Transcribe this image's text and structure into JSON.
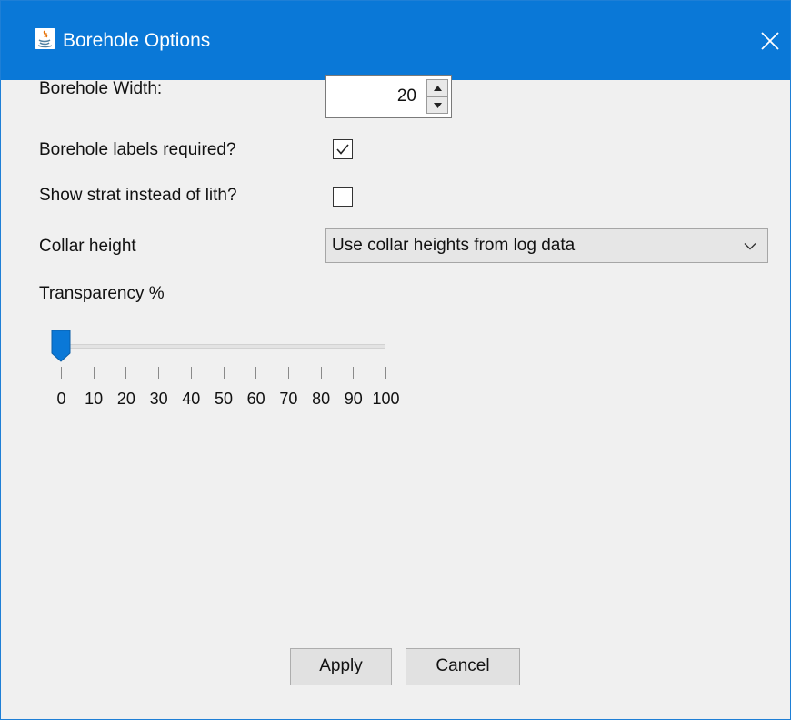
{
  "window": {
    "title": "Borehole Options"
  },
  "borehole_width": {
    "label": "Borehole Width:",
    "value": "20"
  },
  "labels_required": {
    "label": "Borehole labels required?",
    "checked": true
  },
  "show_strat": {
    "label": "Show strat instead of lith?",
    "checked": false
  },
  "collar_height": {
    "label": "Collar height",
    "selected": "Use collar heights from log data"
  },
  "transparency": {
    "label": "Transparency %",
    "value": 0,
    "min": 0,
    "max": 100,
    "tick_labels": [
      "0",
      "10",
      "20",
      "30",
      "40",
      "50",
      "60",
      "70",
      "80",
      "90",
      "100"
    ]
  },
  "buttons": {
    "apply": "Apply",
    "cancel": "Cancel"
  },
  "colors": {
    "titlebar": "#0a78d7",
    "accent": "#0a78d7",
    "background": "#f0f0f0"
  },
  "icons": {
    "app": "java-app-icon",
    "close": "close-icon",
    "checkmark": "checkmark-icon",
    "combo": "chevron-down-icon"
  }
}
